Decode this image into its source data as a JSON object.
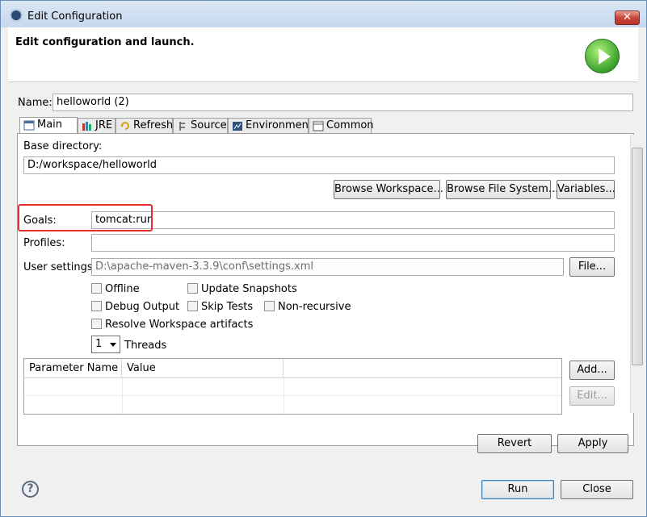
{
  "window": {
    "title": "Edit Configuration",
    "close_label": "✕"
  },
  "banner": {
    "title": "Edit configuration and launch."
  },
  "name": {
    "label": "Name:",
    "value": "helloworld (2)"
  },
  "tabs": [
    {
      "label": "Main",
      "icon": "main-tab-icon"
    },
    {
      "label": "JRE",
      "icon": "jre-icon"
    },
    {
      "label": "Refresh",
      "icon": "refresh-icon"
    },
    {
      "label": "Source",
      "icon": "source-icon"
    },
    {
      "label": "Environment",
      "icon": "environment-icon"
    },
    {
      "label": "Common",
      "icon": "common-icon"
    }
  ],
  "main": {
    "base_directory_label": "Base directory:",
    "base_directory_value": "D:/workspace/helloworld",
    "browse_workspace": "Browse Workspace...",
    "browse_file_system": "Browse File System...",
    "variables": "Variables...",
    "goals_label": "Goals:",
    "goals_value": "tomcat:run",
    "profiles_label": "Profiles:",
    "profiles_value": "",
    "user_settings_label": "User settings:",
    "user_settings_value": "D:\\apache-maven-3.3.9\\conf\\settings.xml",
    "file_button": "File...",
    "checkboxes": {
      "offline": "Offline",
      "update_snapshots": "Update Snapshots",
      "debug_output": "Debug Output",
      "skip_tests": "Skip Tests",
      "non_recursive": "Non-recursive",
      "resolve_workspace": "Resolve Workspace artifacts"
    },
    "threads_value": "1",
    "threads_label": "Threads",
    "table": {
      "columns": [
        "Parameter Name",
        "Value",
        ""
      ]
    },
    "add_button": "Add...",
    "edit_button": "Edit..."
  },
  "footer": {
    "revert": "Revert",
    "apply": "Apply",
    "run": "Run",
    "close": "Close",
    "help_glyph": "?"
  }
}
